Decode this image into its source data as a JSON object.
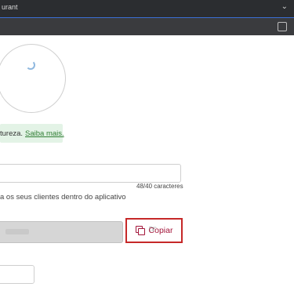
{
  "browser": {
    "tab_title": "urant"
  },
  "info_banner": {
    "text": "tureza.",
    "link": "Saiba mais."
  },
  "name_field": {
    "value": "",
    "counter": "48/40 caracteres"
  },
  "helper_text": "a os seus clientes dentro do aplicativo",
  "copy_button": {
    "label": "Copiar"
  },
  "colors": {
    "accent_red": "#c62828",
    "copy_text": "#a3163a",
    "banner_bg": "#e3f3e6",
    "link_green": "#2e7d32"
  },
  "icons": {
    "copy": "copy-icon",
    "cursor": "pointer-cursor-icon"
  }
}
